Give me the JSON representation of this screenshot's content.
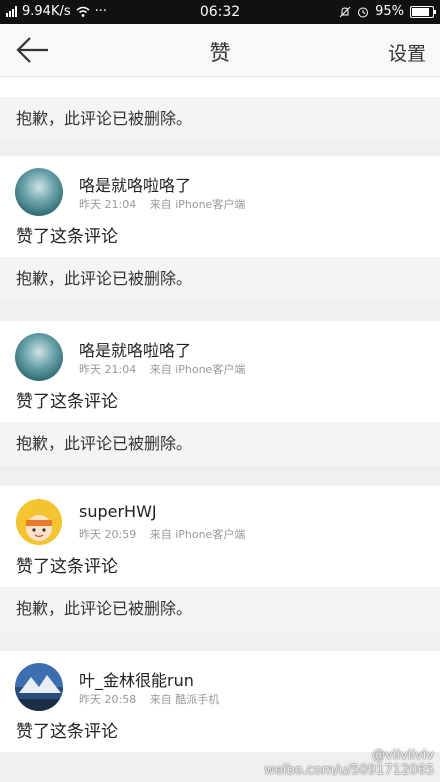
{
  "status_bar": {
    "network_speed": "9.94K/s",
    "dots": "···",
    "time": "06:32",
    "battery": "95%"
  },
  "nav": {
    "title": "赞",
    "settings_label": "设置"
  },
  "feed": {
    "top_quote": "抱歉，此评论已被删除。",
    "items": [
      {
        "username": "咯是就咯啦咯了",
        "time": "昨天 21:04",
        "source": "来自 iPhone客户端",
        "text": "赞了这条评论",
        "quote": "抱歉，此评论已被删除。"
      },
      {
        "username": "咯是就咯啦咯了",
        "time": "昨天 21:04",
        "source": "来自 iPhone客户端",
        "text": "赞了这条评论",
        "quote": "抱歉，此评论已被删除。"
      },
      {
        "username": "superHWJ",
        "time": "昨天 20:59",
        "source": "来自 iPhone客户端",
        "text": "赞了这条评论",
        "quote": "抱歉，此评论已被删除。"
      },
      {
        "username": "叶_金林很能run",
        "time": "昨天 20:58",
        "source": "来自 酷派手机",
        "text": "赞了这条评论"
      }
    ]
  },
  "watermark": {
    "handle": "@viiviiviv",
    "url": "weibo.com/u/5091712065"
  }
}
